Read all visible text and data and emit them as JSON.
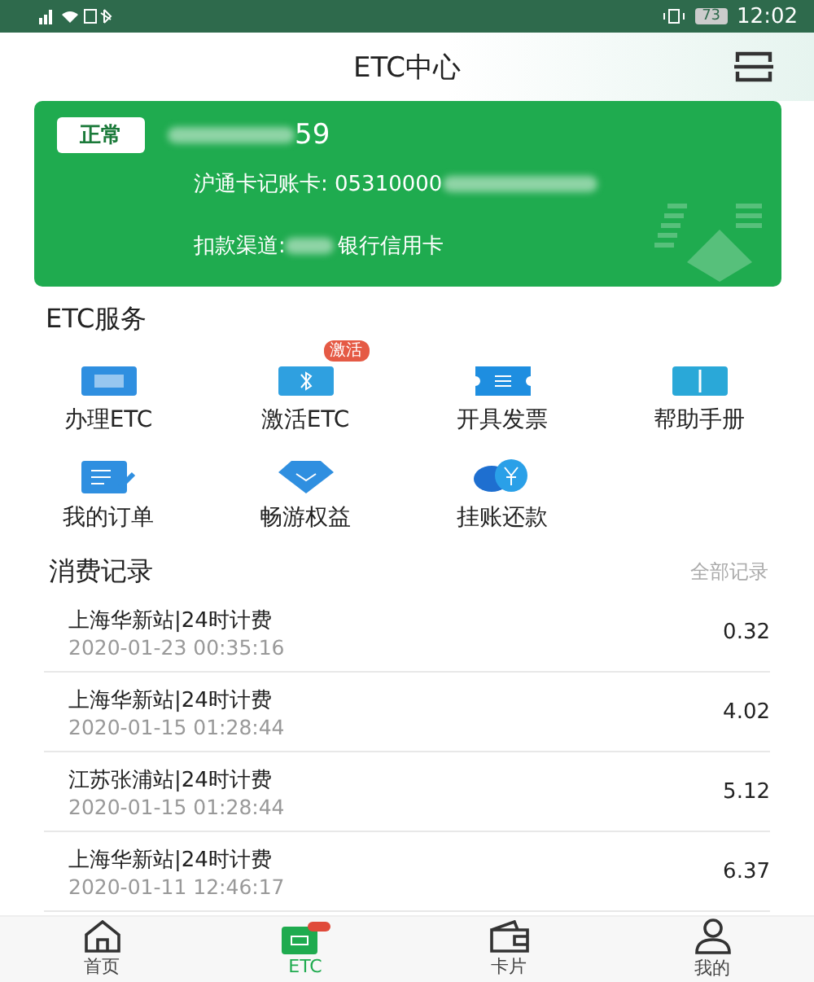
{
  "status_bar": {
    "battery": "73",
    "time": "12:02"
  },
  "header": {
    "title": "ETC中心"
  },
  "card": {
    "status": "正常",
    "plate_suffix": "59",
    "account_label": "沪通卡记账卡: 05310000",
    "channel_label": "扣款渠道:",
    "channel_value": "银行信用卡"
  },
  "services": {
    "title": "ETC服务",
    "items": [
      {
        "label": "办理ETC",
        "kind": "etc"
      },
      {
        "label": "激活ETC",
        "kind": "activate",
        "badge": "激活"
      },
      {
        "label": "开具发票",
        "kind": "ticket"
      },
      {
        "label": "帮助手册",
        "kind": "book"
      },
      {
        "label": "我的订单",
        "kind": "order"
      },
      {
        "label": "畅游权益",
        "kind": "gem"
      },
      {
        "label": "挂账还款",
        "kind": "coin"
      }
    ]
  },
  "records": {
    "title": "消费记录",
    "all_link": "全部记录",
    "rows": [
      {
        "name": "上海华新站|24时计费",
        "time": "2020-01-23 00:35:16",
        "amount": "0.32"
      },
      {
        "name": "上海华新站|24时计费",
        "time": "2020-01-15 01:28:44",
        "amount": "4.02"
      },
      {
        "name": "江苏张浦站|24时计费",
        "time": "2020-01-15 01:28:44",
        "amount": "5.12"
      },
      {
        "name": "上海华新站|24时计费",
        "time": "2020-01-11 12:46:17",
        "amount": "6.37"
      }
    ]
  },
  "tab_bar": [
    {
      "label": "首页",
      "kind": "home",
      "selected": false
    },
    {
      "label": "ETC",
      "kind": "etc",
      "selected": true
    },
    {
      "label": "卡片",
      "kind": "wallet",
      "selected": false
    },
    {
      "label": "我的",
      "kind": "person",
      "selected": false
    }
  ]
}
